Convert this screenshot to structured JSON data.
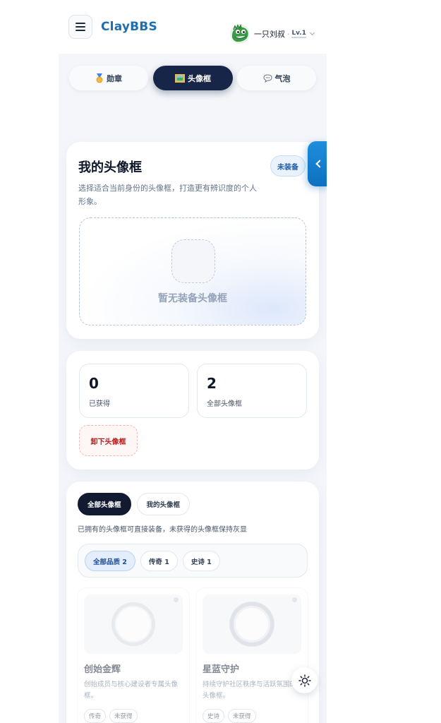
{
  "header": {
    "brand": "ClayBBS",
    "user_name": "一只刘叔",
    "separator": "·",
    "level": "Lv.1"
  },
  "tabs": [
    {
      "label": "勋章",
      "icon": "medal-icon",
      "active": false
    },
    {
      "label": "头像框",
      "icon": "picture-frame-icon",
      "active": true
    },
    {
      "label": "气泡",
      "icon": "speech-bubble-icon",
      "active": false
    }
  ],
  "my_frame": {
    "title": "我的头像框",
    "description": "选择适合当前身份的头像框，打造更有辨识度的个人形象。",
    "status": "未装备",
    "empty_text": "暂无装备头像框"
  },
  "stats": {
    "owned_count": "0",
    "owned_label": "已获得",
    "total_count": "2",
    "total_label": "全部头像框",
    "unequip_label": "卸下头像框"
  },
  "catalog": {
    "filters": [
      {
        "label": "全部头像框",
        "active": true
      },
      {
        "label": "我的头像框",
        "active": false
      }
    ],
    "hint": "已拥有的头像框可直接装备，未获得的头像框保持灰显",
    "qualities": [
      {
        "label": "全部品质 2",
        "active": true
      },
      {
        "label": "传奇 1",
        "active": false
      },
      {
        "label": "史诗 1",
        "active": false
      }
    ],
    "items": [
      {
        "name": "创始金辉",
        "description": "创始成员与核心建设者专属头像框。",
        "rarity": "传奇",
        "status": "未获得"
      },
      {
        "name": "星蓝守护",
        "description": "持续守护社区秩序与活跃氛围的头像框。",
        "rarity": "史诗",
        "status": "未获得"
      }
    ]
  },
  "colors": {
    "brand": "#1e6fb0",
    "active_tab": "#172548",
    "side_handle": "#0e6fbf",
    "danger": "#b91c1c"
  }
}
